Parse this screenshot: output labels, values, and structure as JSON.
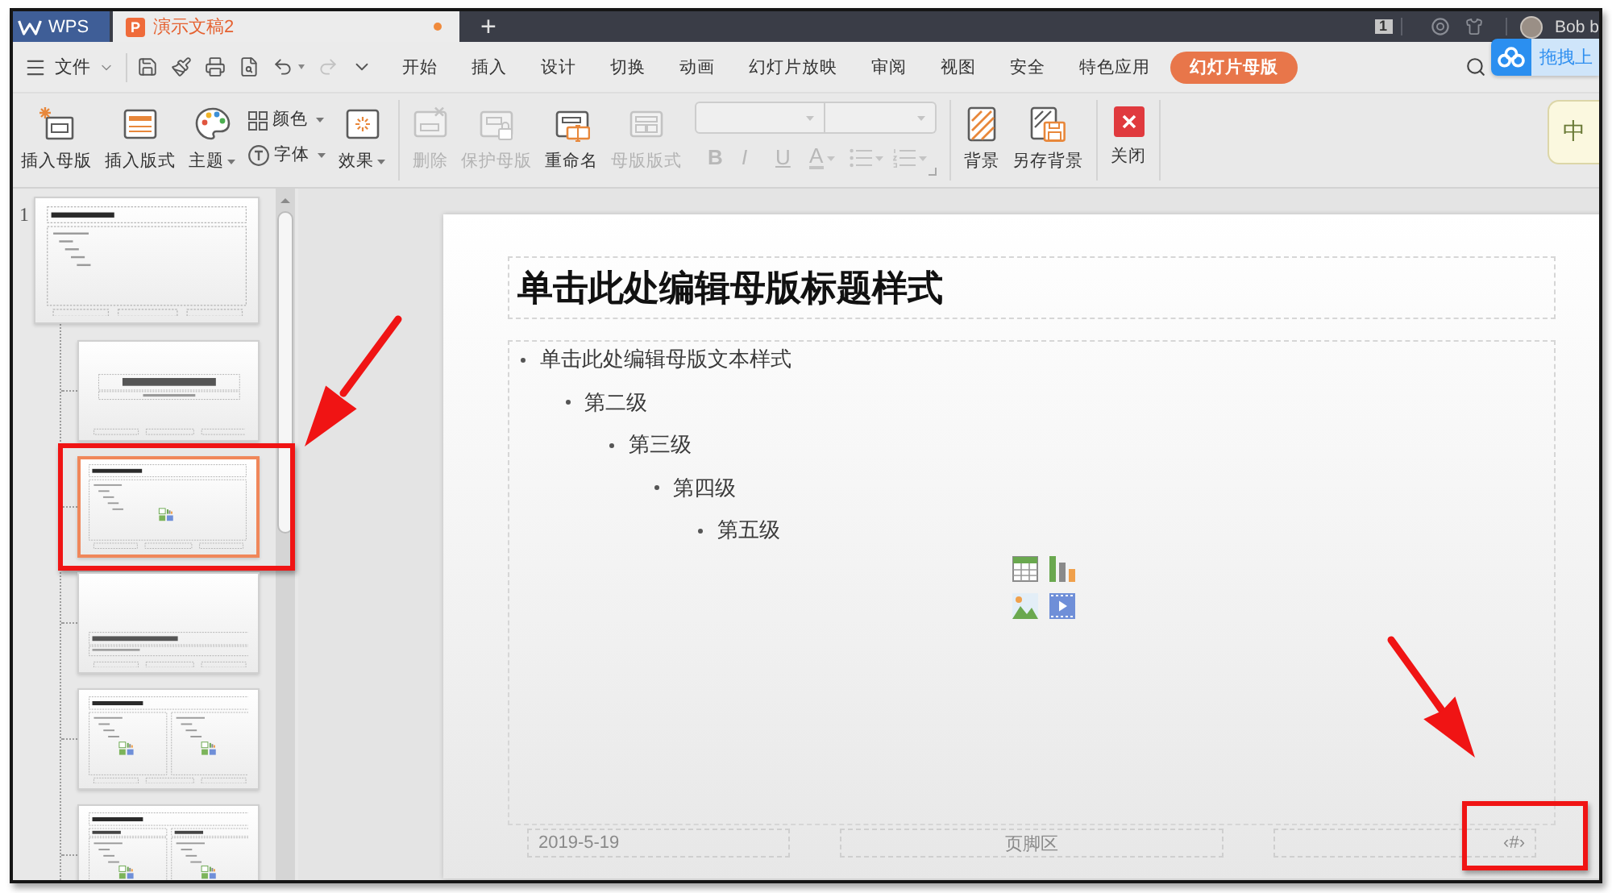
{
  "title_bar": {
    "app_tab": {
      "label": "WPS"
    },
    "document_tabs": [
      {
        "type_mark": "P",
        "label": "演示文稿2",
        "selected": true,
        "modified": true
      }
    ],
    "new_tab": "+",
    "message_count": "1",
    "user_name": "Bob b"
  },
  "cloud_button": {
    "label": "拖拽上"
  },
  "input_method": {
    "label": "中"
  },
  "menu_bar": {
    "file_menu": "文件",
    "quick_access": [
      {
        "kind": "save",
        "disabled": false
      },
      {
        "kind": "brush",
        "disabled": false
      },
      {
        "kind": "print",
        "disabled": false
      },
      {
        "kind": "preview",
        "disabled": false
      },
      {
        "kind": "undo",
        "disabled": false
      },
      {
        "kind": "redo",
        "disabled": true
      },
      {
        "kind": "customize",
        "disabled": false
      }
    ],
    "tabs": [
      {
        "label": "开始",
        "selected": false
      },
      {
        "label": "插入",
        "selected": false
      },
      {
        "label": "设计",
        "selected": false
      },
      {
        "label": "切换",
        "selected": false
      },
      {
        "label": "动画",
        "selected": false
      },
      {
        "label": "幻灯片放映",
        "selected": false
      },
      {
        "label": "审阅",
        "selected": false
      },
      {
        "label": "视图",
        "selected": false
      },
      {
        "label": "安全",
        "selected": false
      },
      {
        "label": "特色应用",
        "selected": false
      },
      {
        "label": "幻灯片母版",
        "selected": true
      }
    ]
  },
  "ribbon": {
    "groups": [
      {
        "items": [
          {
            "kind": "master",
            "label": "插入母版",
            "disabled": false,
            "dropdown": false
          },
          {
            "kind": "layout",
            "label": "插入版式",
            "disabled": false,
            "dropdown": false
          },
          {
            "kind": "theme",
            "label": "主题",
            "disabled": false,
            "dropdown": true
          },
          {
            "kind": "colors",
            "label": "颜色",
            "disabled": false,
            "dropdown": true
          },
          {
            "kind": "fonts",
            "label": "字体",
            "disabled": false,
            "dropdown": true
          },
          {
            "kind": "effects",
            "label": "效果",
            "disabled": false,
            "dropdown": true
          }
        ]
      },
      {
        "items": [
          {
            "kind": "delete",
            "label": "删除",
            "disabled": true,
            "dropdown": false
          },
          {
            "kind": "protect",
            "label": "保护母版",
            "disabled": true,
            "dropdown": false
          },
          {
            "kind": "rename",
            "label": "重命名",
            "disabled": false,
            "dropdown": false
          },
          {
            "kind": "placeholders",
            "label": "母版版式",
            "disabled": true,
            "dropdown": false
          },
          {
            "kind": "fontname",
            "disabled": true
          },
          {
            "kind": "fontsize",
            "disabled": true
          },
          {
            "kind": "bold",
            "label": "B",
            "disabled": true,
            "dropdown": false
          },
          {
            "kind": "italic",
            "label": "I",
            "disabled": true,
            "dropdown": false
          },
          {
            "kind": "underline",
            "label": "U",
            "disabled": true,
            "dropdown": false
          },
          {
            "kind": "fontcolor",
            "label": "A",
            "disabled": true,
            "dropdown": true
          },
          {
            "kind": "bullets",
            "disabled": true,
            "dropdown": true
          },
          {
            "kind": "numbering",
            "disabled": true,
            "dropdown": true
          }
        ]
      },
      {
        "items": [
          {
            "kind": "background",
            "label": "背景",
            "disabled": false,
            "dropdown": false
          },
          {
            "kind": "savebackground",
            "label": "另存背景",
            "disabled": false,
            "dropdown": false
          }
        ]
      },
      {
        "items": [
          {
            "kind": "close",
            "label": "关闭",
            "disabled": false,
            "dropdown": false
          }
        ]
      }
    ]
  },
  "slide_panel": {
    "thumbnails": [
      {
        "kind": "master",
        "number": "1",
        "selected": false,
        "annotated": false
      },
      {
        "kind": "title",
        "selected": false,
        "annotated": false
      },
      {
        "kind": "content",
        "selected": true,
        "annotated": true
      },
      {
        "kind": "section",
        "selected": false,
        "annotated": false
      },
      {
        "kind": "two",
        "selected": false,
        "annotated": false
      },
      {
        "kind": "comparison",
        "selected": false,
        "annotated": false
      }
    ]
  },
  "slide": {
    "title": "单击此处编辑母版标题样式",
    "outline": [
      {
        "text": "单击此处编辑母版文本样式",
        "children": [
          {
            "text": "第二级",
            "children": [
              {
                "text": "第三级",
                "children": [
                  {
                    "text": "第四级",
                    "children": [
                      {
                        "text": "第五级"
                      }
                    ]
                  }
                ]
              }
            ]
          }
        ]
      }
    ],
    "footers": [
      {
        "kind": "date",
        "text": "2019-5-19",
        "annotated": false
      },
      {
        "kind": "footer",
        "text": "页脚区",
        "annotated": false
      },
      {
        "kind": "number",
        "text": "‹#›",
        "annotated": true
      }
    ]
  }
}
